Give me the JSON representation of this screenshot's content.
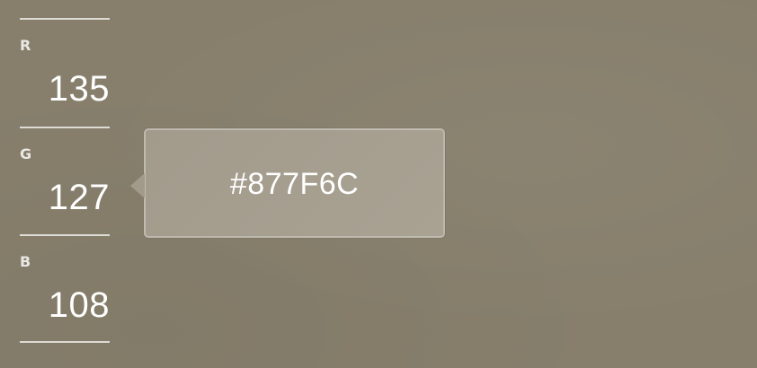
{
  "channels": [
    {
      "label": "R",
      "value": "135"
    },
    {
      "label": "G",
      "value": "127"
    },
    {
      "label": "B",
      "value": "108"
    }
  ],
  "tooltip": {
    "hex": "#877F6C"
  },
  "colors": {
    "background": "#877F6C",
    "tooltip_fill": "#A59E8F",
    "text": "#FFFFFF"
  }
}
